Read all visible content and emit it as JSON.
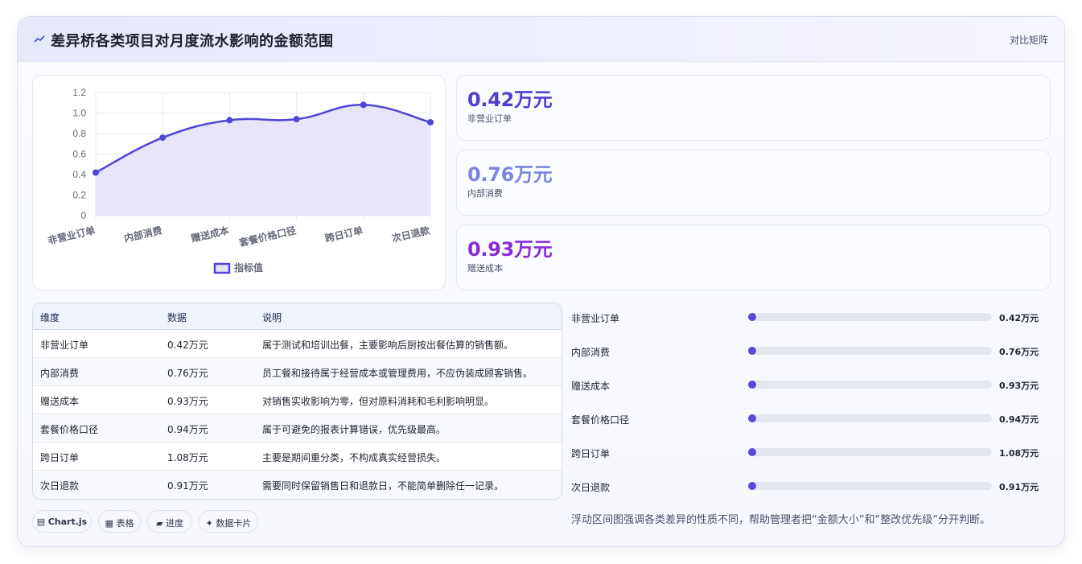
{
  "header": {
    "title": "差异桥各类项目对月度流水影响的金额范围",
    "link": "对比矩阵"
  },
  "colors": {
    "accent": "#5046d6",
    "fill": "#e4e1f8",
    "kpi1": "#4f3fd1",
    "kpi2": "#7b86e0",
    "kpi3": "#8a2bd6"
  },
  "chart_data": {
    "type": "area",
    "categories": [
      "非营业订单",
      "内部消费",
      "赠送成本",
      "套餐价格口径",
      "跨日订单",
      "次日退款"
    ],
    "series": [
      {
        "name": "指标值",
        "values": [
          0.42,
          0.76,
          0.93,
          0.94,
          1.08,
          0.91
        ]
      }
    ],
    "ylim": [
      0,
      1.2
    ],
    "yticks": [
      "0",
      "0.2",
      "0.4",
      "0.6",
      "0.8",
      "1.0",
      "1.2"
    ],
    "grid": true,
    "legend": "bottom"
  },
  "kpis": [
    {
      "value": "0.42万元",
      "label": "非营业订单"
    },
    {
      "value": "0.76万元",
      "label": "内部消费"
    },
    {
      "value": "0.93万元",
      "label": "赠送成本"
    }
  ],
  "table": {
    "headers": [
      "维度",
      "数据",
      "说明"
    ],
    "rows": [
      [
        "非营业订单",
        "0.42万元",
        "属于测试和培训出餐，主要影响后厨按出餐估算的销售额。"
      ],
      [
        "内部消费",
        "0.76万元",
        "员工餐和接待属于经营成本或管理费用，不应伪装成顾客销售。"
      ],
      [
        "赠送成本",
        "0.93万元",
        "对销售实收影响为零，但对原料消耗和毛利影响明显。"
      ],
      [
        "套餐价格口径",
        "0.94万元",
        "属于可避免的报表计算错误，优先级最高。"
      ],
      [
        "跨日订单",
        "1.08万元",
        "主要是期间重分类，不构成真实经营损失。"
      ],
      [
        "次日退款",
        "0.91万元",
        "需要同时保留销售日和退款日，不能简单删除任一记录。"
      ]
    ]
  },
  "progress": [
    {
      "label": "非营业订单",
      "value": "0.42万元",
      "fraction": 0.0
    },
    {
      "label": "内部消费",
      "value": "0.76万元",
      "fraction": 0.0
    },
    {
      "label": "赠送成本",
      "value": "0.93万元",
      "fraction": 0.0
    },
    {
      "label": "套餐价格口径",
      "value": "0.94万元",
      "fraction": 0.0
    },
    {
      "label": "跨日订单",
      "value": "1.08万元",
      "fraction": 0.0
    },
    {
      "label": "次日退款",
      "value": "0.91万元",
      "fraction": 0.0
    }
  ],
  "tags": [
    {
      "icon": "▤",
      "label": "Chart.js"
    },
    {
      "icon": "▦",
      "label": "表格"
    },
    {
      "icon": "▰",
      "label": "进度"
    },
    {
      "icon": "✦",
      "label": "数据卡片"
    }
  ],
  "note": "浮动区间图强调各类差异的性质不同，帮助管理者把“金额大小”和“整改优先级”分开判断。"
}
